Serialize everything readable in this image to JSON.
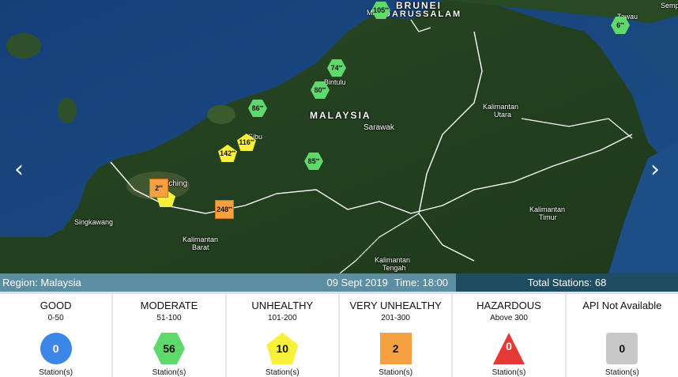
{
  "map": {
    "labels": {
      "brunei": "BRUNEI",
      "darussalam": "DARUSSALAM",
      "malaysia": "MALAYSIA",
      "sarawak": "Sarawak",
      "bintulu": "Bintulu",
      "sibu": "Sibu",
      "kuching": "Kuching",
      "singkawang": "Singkawang",
      "kal_barat_1": "Kalimantan",
      "kal_barat_2": "Barat",
      "kal_utara_1": "Kalimantan",
      "kal_utara_2": "Utara",
      "kal_timur_1": "Kalimantan",
      "kal_timur_2": "Timur",
      "kal_tengah_1": "Kalimantan",
      "kal_tengah_2": "Tengah",
      "tawau": "Tawau",
      "semp": "Semp",
      "miri": "Mi"
    },
    "markers": [
      {
        "value": "105",
        "level": "moderate"
      },
      {
        "value": "74",
        "level": "moderate"
      },
      {
        "value": "80",
        "level": "moderate"
      },
      {
        "value": "86",
        "level": "moderate"
      },
      {
        "value": "116",
        "level": "unhealthy"
      },
      {
        "value": "142",
        "level": "unhealthy"
      },
      {
        "value": "85",
        "level": "moderate"
      },
      {
        "value": "2",
        "level": "very_unhealthy"
      },
      {
        "value": "248",
        "level": "very_unhealthy"
      },
      {
        "value": "6",
        "level": "moderate"
      }
    ],
    "marker_suffix": "**",
    "nav_prev": "‹",
    "nav_next": "›"
  },
  "infobar": {
    "region": "Region: Malaysia",
    "date": "09 Sept 2019",
    "time": "Time: 18:00",
    "total": "Total Stations: 68"
  },
  "legend": [
    {
      "label": "GOOD",
      "range": "0-50",
      "count": "0",
      "unit": "Station(s)",
      "color": "#3b86e6"
    },
    {
      "label": "MODERATE",
      "range": "51-100",
      "count": "56",
      "unit": "Station(s)",
      "color": "#5fd96b"
    },
    {
      "label": "UNHEALTHY",
      "range": "101-200",
      "count": "10",
      "unit": "Station(s)",
      "color": "#f7f13a"
    },
    {
      "label": "VERY UNHEALTHY",
      "range": "201-300",
      "count": "2",
      "unit": "Station(s)",
      "color": "#f5a142"
    },
    {
      "label": "HAZARDOUS",
      "range": "Above 300",
      "count": "0",
      "unit": "Station(s)",
      "color": "#e53935"
    },
    {
      "label": "API Not Available",
      "range": "",
      "count": "0",
      "unit": "Station(s)",
      "color": "#c8c8c8"
    }
  ]
}
